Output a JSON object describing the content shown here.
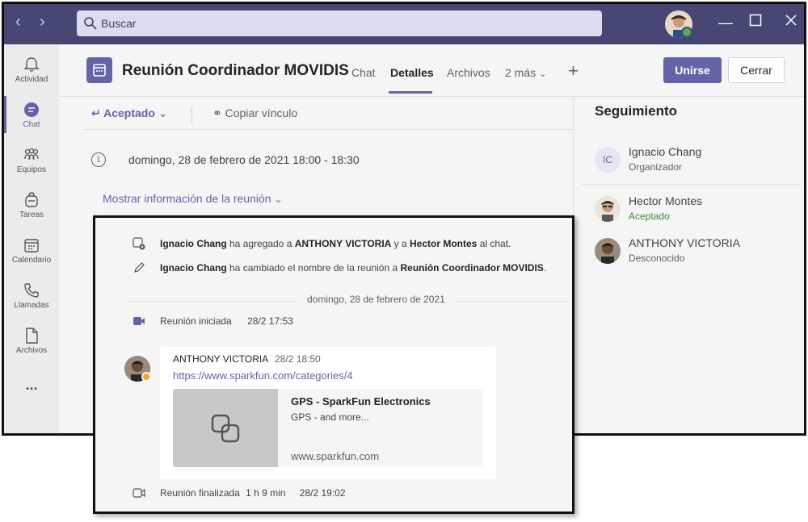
{
  "header": {
    "search_placeholder": "Buscar"
  },
  "rail": {
    "items": [
      {
        "label": "Actividad"
      },
      {
        "label": "Chat"
      },
      {
        "label": "Equipos"
      },
      {
        "label": "Tareas"
      },
      {
        "label": "Calendario"
      },
      {
        "label": "Llamadas"
      },
      {
        "label": "Archivos"
      }
    ],
    "more": "..."
  },
  "meeting": {
    "title": "Reunión Coordinador MOVIDIS",
    "tabs": [
      "Chat",
      "Detalles",
      "Archivos",
      "2 más"
    ],
    "active_tab": "Detalles",
    "join_label": "Unirse",
    "close_label": "Cerrar",
    "response_label": "Aceptado",
    "copy_link_label": "Copiar vínculo",
    "date_time": "domingo, 28 de febrero de 2021 18:00 - 18:30",
    "show_info_label": "Mostrar información de la reunión"
  },
  "tracking": {
    "title": "Seguimiento",
    "people": [
      {
        "initials": "IC",
        "name": "Ignacio Chang",
        "status": "Organizador"
      },
      {
        "name": "Hector Montes",
        "status": "Aceptado"
      },
      {
        "name": "ANTHONY VICTORIA",
        "status": "Desconocido"
      }
    ]
  },
  "chat": {
    "system_messages": [
      {
        "actor": "Ignacio Chang",
        "text1": " ha agregado a ",
        "bold1": "ANTHONY VICTORIA",
        "text2": " y a ",
        "bold2": "Hector Montes",
        "text3": " al chat."
      },
      {
        "actor": "Ignacio Chang",
        "text1": " ha cambiado el nombre de la reunión a ",
        "bold1": "Reunión Coordinador MOVIDIS",
        "text2": "."
      }
    ],
    "date_separator": "domingo, 28 de febrero de 2021",
    "meeting_started": {
      "label": "Reunión iniciada",
      "time": "28/2 17:53"
    },
    "message": {
      "author": "ANTHONY VICTORIA",
      "time": "28/2 18:50",
      "link": "https://www.sparkfun.com/categories/4",
      "preview": {
        "title": "GPS - SparkFun Electronics",
        "description": "GPS - and more...",
        "domain": "www.sparkfun.com"
      }
    },
    "meeting_ended": {
      "label": "Reunión finalizada",
      "duration": "1 h 9 min",
      "time": "28/2 19:02"
    }
  },
  "colors": {
    "titlebar": "#464775",
    "accent": "#6264a7",
    "accepted_green": "#3c8a3c",
    "away": "#f5a623"
  }
}
